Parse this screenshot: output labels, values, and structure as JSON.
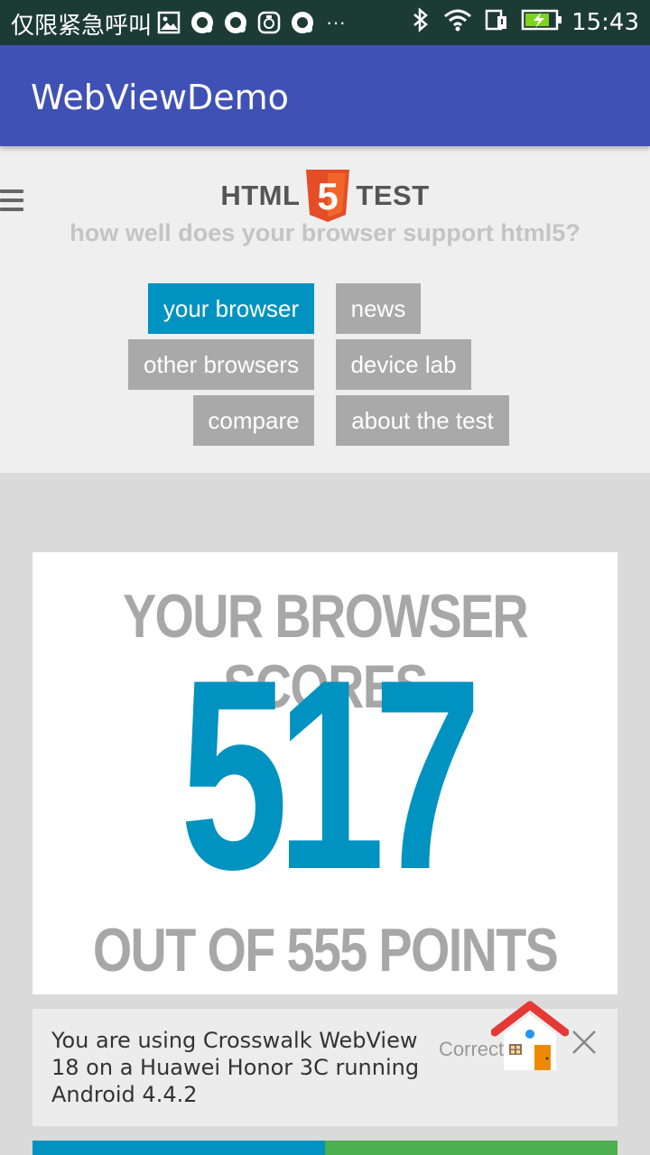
{
  "status_bar": {
    "carrier": "仅限紧急呼叫",
    "time": "15:43",
    "more": "···",
    "icons": [
      "image-icon",
      "qq-icon",
      "qq-icon",
      "app-icon",
      "qq-icon",
      "bluetooth-icon",
      "wifi-icon",
      "sim-icon",
      "battery-icon"
    ]
  },
  "app_bar": {
    "title": "WebViewDemo"
  },
  "web": {
    "logo_left": "HTML",
    "logo_number": "5",
    "logo_right": "TEST",
    "tagline": "how well does your browser support html5?",
    "nav": [
      {
        "label": "your browser",
        "active": true
      },
      {
        "label": "news",
        "active": false
      },
      {
        "label": "other browsers",
        "active": false
      },
      {
        "label": "device lab",
        "active": false
      },
      {
        "label": "compare",
        "active": false
      },
      {
        "label": "about the test",
        "active": false
      }
    ]
  },
  "score": {
    "title": "YOUR BROWSER SCORES",
    "value": "517",
    "subtitle": "OUT OF 555 POINTS"
  },
  "info": {
    "text": "You are using Crosswalk WebView 18 on a Huawei Honor 3C running Android 4.4.2",
    "correct_label": "Correct"
  },
  "colors": {
    "accent": "#0092c0",
    "app_bar": "#3f51b5",
    "button_gray": "#a9a9a9",
    "score_gray": "#a7a7a7"
  }
}
